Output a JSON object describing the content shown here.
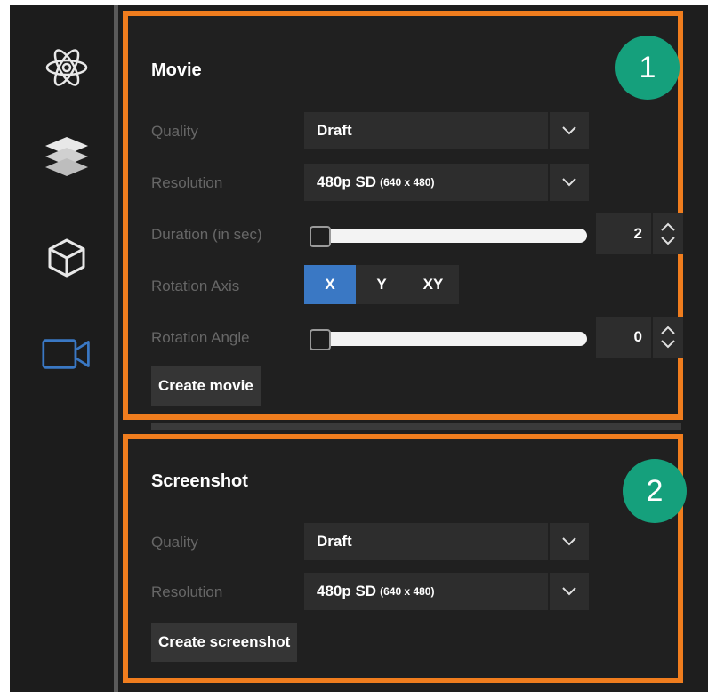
{
  "sidebar": {
    "items": [
      {
        "icon": "atom-icon"
      },
      {
        "icon": "layers-icon"
      },
      {
        "icon": "cube-icon"
      },
      {
        "icon": "video-camera-icon",
        "active": true
      }
    ]
  },
  "movie": {
    "title": "Movie",
    "badge": "1",
    "quality": {
      "label": "Quality",
      "value": "Draft"
    },
    "resolution": {
      "label": "Resolution",
      "value": "480p SD",
      "detail": "(640 x 480)"
    },
    "duration": {
      "label": "Duration (in sec)",
      "value": "2"
    },
    "rotation_axis": {
      "label": "Rotation Axis",
      "options": [
        "X",
        "Y",
        "XY"
      ],
      "selected": "X"
    },
    "rotation_angle": {
      "label": "Rotation Angle",
      "value": "0"
    },
    "create_button": "Create movie"
  },
  "screenshot": {
    "title": "Screenshot",
    "badge": "2",
    "quality": {
      "label": "Quality",
      "value": "Draft"
    },
    "resolution": {
      "label": "Resolution",
      "value": "480p SD",
      "detail": "(640 x 480)"
    },
    "create_button": "Create screenshot"
  },
  "colors": {
    "highlight_border": "#f07d1e",
    "badge": "#15a07c",
    "active_tab": "#3a78c4",
    "active_icon": "#3a78c4"
  }
}
